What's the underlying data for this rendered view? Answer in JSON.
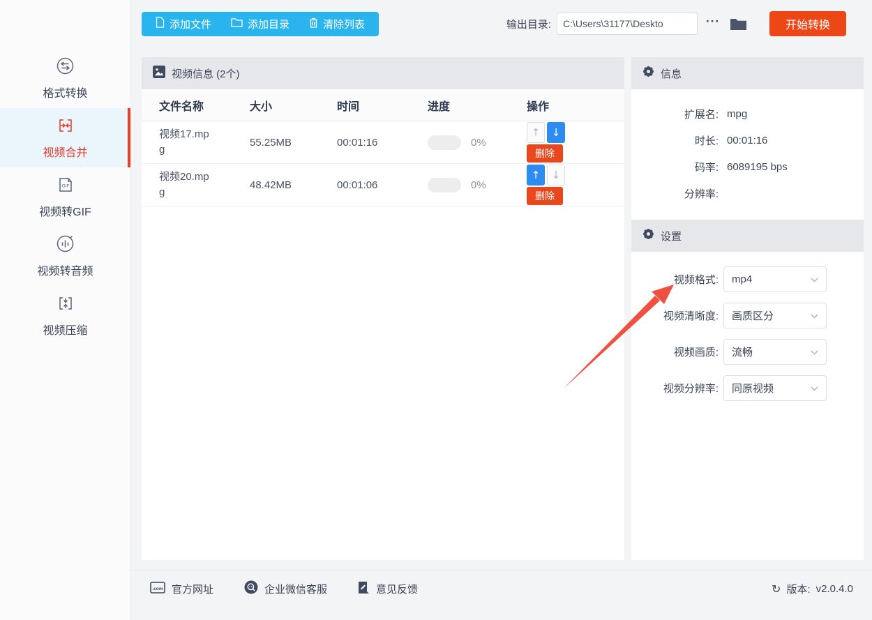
{
  "colors": {
    "toolbar_blue": "#29b4ee",
    "accent_red": "#ed4717",
    "active_blue": "#2e8bf0",
    "nav_active_red": "#e6392b"
  },
  "sidebar": {
    "items": [
      {
        "label": "格式转换",
        "active": false
      },
      {
        "label": "视频合并",
        "active": true
      },
      {
        "label": "视频转GIF",
        "active": false
      },
      {
        "label": "视频转音频",
        "active": false
      },
      {
        "label": "视频压缩",
        "active": false
      }
    ]
  },
  "toolbar": {
    "add_file": "添加文件",
    "add_dir": "添加目录",
    "clear_list": "清除列表",
    "output_label": "输出目录:",
    "output_path": "C:\\Users\\31177\\Deskto",
    "ellipsis": "···",
    "start": "开始转换"
  },
  "table": {
    "title": "视频信息 (2个)",
    "columns": [
      "文件名称",
      "大小",
      "时间",
      "进度",
      "操作"
    ],
    "rows": [
      {
        "name": "视频17.mpg",
        "size": "55.25MB",
        "time": "00:01:16",
        "progress": "0%",
        "up_enabled": false,
        "down_enabled": true,
        "delete": "删除"
      },
      {
        "name": "视频20.mpg",
        "size": "48.42MB",
        "time": "00:01:06",
        "progress": "0%",
        "up_enabled": true,
        "down_enabled": false,
        "delete": "删除"
      }
    ]
  },
  "icons": {
    "up_arrow": "↑",
    "down_arrow": "↓",
    "refresh": "↻"
  },
  "info": {
    "title": "信息",
    "rows": [
      {
        "label": "扩展名:",
        "value": "mpg"
      },
      {
        "label": "时长:",
        "value": "00:01:16"
      },
      {
        "label": "码率:",
        "value": "6089195 bps"
      },
      {
        "label": "分辨率:",
        "value": ""
      }
    ]
  },
  "settings": {
    "title": "设置",
    "rows": [
      {
        "label": "视频格式:",
        "value": "mp4"
      },
      {
        "label": "视频清晰度:",
        "value": "画质区分"
      },
      {
        "label": "视频画质:",
        "value": "流畅"
      },
      {
        "label": "视频分辨率:",
        "value": "同原视频"
      }
    ]
  },
  "footer": {
    "links": [
      "官方网址",
      "企业微信客服",
      "意见反馈"
    ],
    "version_label": "版本:",
    "version": "v2.0.4.0"
  }
}
